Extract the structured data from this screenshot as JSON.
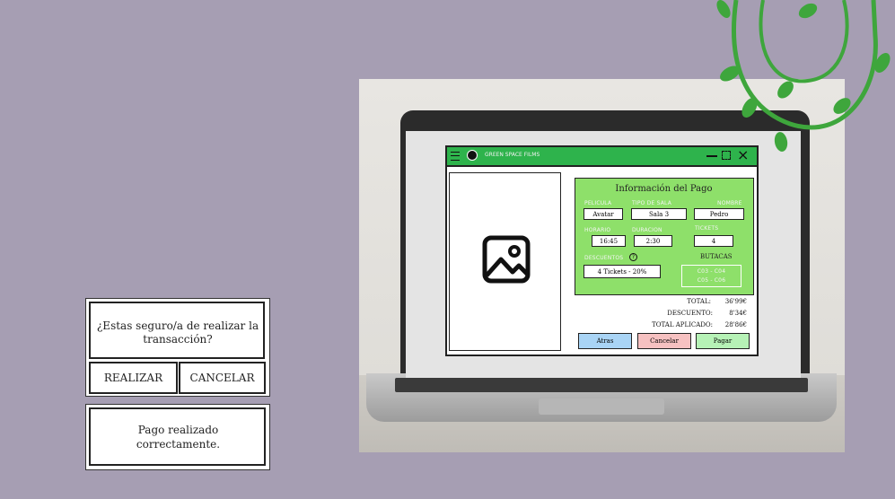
{
  "dialog_confirm": {
    "question": "¿Estas seguro/a de realizar la transacción?",
    "realizar_label": "REALIZAR",
    "cancelar_label": "CANCELAR"
  },
  "dialog_success": {
    "message": "Pago realizado correctamente."
  },
  "app": {
    "title": "GREEN SPACE FILMS",
    "panel_title": "Información del Pago",
    "fields": {
      "pelicula_label": "PELICULA",
      "pelicula_value": "Avatar",
      "tipo_sala_label": "TIPO DE SALA",
      "tipo_sala_value": "Sala 3",
      "nombre_label": "NOMBRE",
      "nombre_value": "Pedro",
      "horario_label": "HORARIO",
      "horario_value": "16:45",
      "duracion_label": "DURACION",
      "duracion_value": "2:30",
      "tickets_label": "TICKETS",
      "tickets_value": "4",
      "descuentos_label": "DESCUENTOS",
      "descuentos_value": "4 Tickets - 20%",
      "butacas_label": "BUTACAS",
      "butacas_line1": "C03 - C04",
      "butacas_line2": "C05 - C06"
    },
    "totals": {
      "total_label": "TOTAL:",
      "total_value": "36'99€",
      "descuento_label": "DESCUENTO:",
      "descuento_value": "8'34€",
      "aplicado_label": "TOTAL APLICADO:",
      "aplicado_value": "28'86€"
    },
    "buttons": {
      "atras": "Atras",
      "cancelar": "Cancelar",
      "pagar": "Pagar"
    }
  },
  "colors": {
    "background": "#a69eb3",
    "titlebar": "#2eb34c",
    "panel": "#8ee06a",
    "atras": "#a9d4f5",
    "cancelar": "#f6c1c1",
    "pagar": "#b6f2b6",
    "leaf": "#3ea63c"
  }
}
